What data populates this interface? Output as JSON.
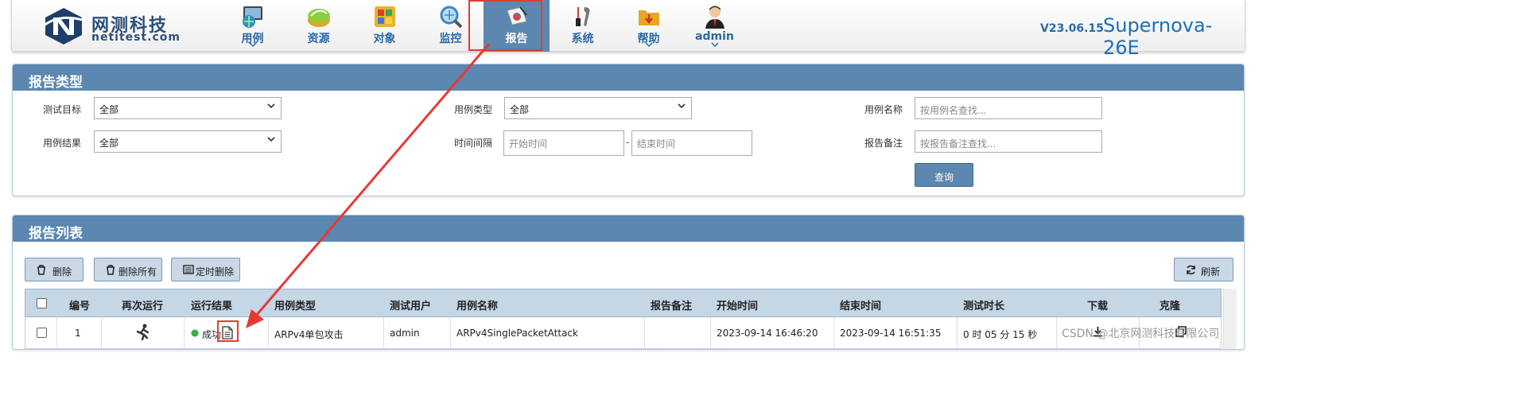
{
  "logo": {
    "cn": "网测科技",
    "en": "netitest.com"
  },
  "nav": [
    {
      "label": "用例",
      "icon": "monitor-globe-icon",
      "chevron": true
    },
    {
      "label": "资源",
      "icon": "resource-disc-icon",
      "chevron": false
    },
    {
      "label": "对象",
      "icon": "objects-grid-icon",
      "chevron": false
    },
    {
      "label": "监控",
      "icon": "monitor-magnifier-icon",
      "chevron": false
    },
    {
      "label": "报告",
      "icon": "report-chart-icon",
      "chevron": false,
      "active": true
    },
    {
      "label": "系统",
      "icon": "tools-icon",
      "chevron": false
    },
    {
      "label": "帮助",
      "icon": "help-folder-icon",
      "chevron": true
    },
    {
      "label": "admin",
      "icon": "user-avatar-icon",
      "chevron": true
    }
  ],
  "version": "V23.06.15",
  "product": "Supernova-26E",
  "filter": {
    "title": "报告类型",
    "target_label": "测试目标",
    "target_value": "全部",
    "type_label": "用例类型",
    "type_value": "全部",
    "name_label": "用例名称",
    "name_placeholder": "按用例名查找...",
    "result_label": "用例结果",
    "result_value": "全部",
    "interval_label": "时间间隔",
    "start_placeholder": "开始时间",
    "interval_sep": "-",
    "end_placeholder": "结束时间",
    "remark_label": "报告备注",
    "remark_placeholder": "按报告备注查找...",
    "query_label": "查询"
  },
  "list": {
    "title": "报告列表",
    "delete_label": "删除",
    "delete_all_label": "删除所有",
    "scheduled_delete_label": "定时删除",
    "refresh_label": "刷新",
    "columns": [
      "编号",
      "再次运行",
      "运行结果",
      "用例类型",
      "测试用户",
      "用例名称",
      "报告备注",
      "开始时间",
      "结束时间",
      "测试时长",
      "下载",
      "克隆"
    ],
    "rows": [
      {
        "id": "1",
        "result": "成功",
        "type": "ARPv4单包攻击",
        "user": "admin",
        "name": "ARPv4SinglePacketAttack",
        "remark": "",
        "start": "2023-09-14 16:46:20",
        "end": "2023-09-14 16:51:35",
        "duration": "0 时 05 分 15 秒"
      }
    ]
  },
  "watermark": "CSDN @北京网测科技有限公司",
  "colors": {
    "header_blue": "#5b87b0",
    "accent_text": "#2a69a8",
    "success": "#2fb344",
    "annotation_red": "#e53935"
  }
}
